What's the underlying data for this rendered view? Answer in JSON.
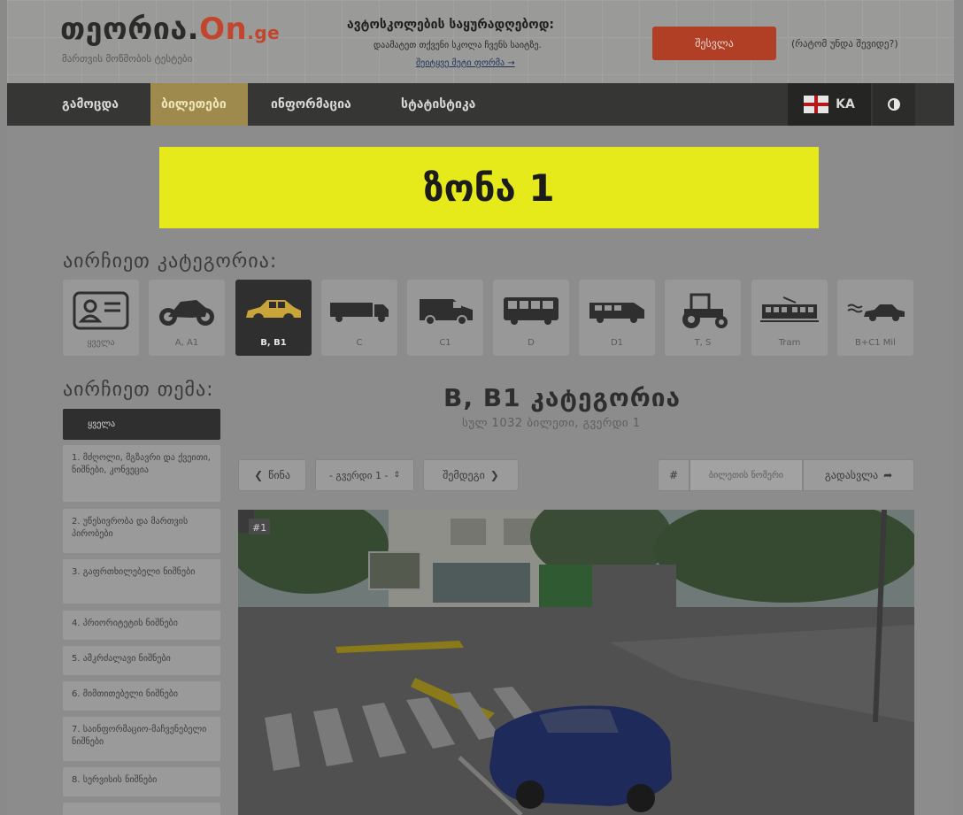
{
  "header": {
    "logo_main": "თეორია.",
    "logo_on": "On",
    "logo_ge": ".ge",
    "logo_subtitle": "მართვის მოწმობის ტესტები",
    "promo_title": "ავტოსკოლების საყურადღებოდ:",
    "promo_line": "დაამატეთ თქვენი სკოლა ჩვენს საიტზე.",
    "promo_link": "შეიტყვე მეტი ფორმა →",
    "login_button": "შესვლა",
    "why_link": "(რატომ უნდა შევიდე?)"
  },
  "nav": {
    "items": [
      {
        "label": "გამოცდა"
      },
      {
        "label": "ბილეთები"
      },
      {
        "label": "ინფორმაცია"
      },
      {
        "label": "სტატისტიკა"
      }
    ],
    "active_index": 1,
    "lang_label": "KA"
  },
  "zone_banner": "ზონა 1",
  "choose_category_title": "აირჩიეთ კატეგორია:",
  "categories": [
    {
      "label": "ყველა",
      "icon": "id-card-icon"
    },
    {
      "label": "A, A1",
      "icon": "motorcycle-icon"
    },
    {
      "label": "B, B1",
      "icon": "car-icon"
    },
    {
      "label": "C",
      "icon": "truck-icon"
    },
    {
      "label": "C1",
      "icon": "van-icon"
    },
    {
      "label": "D",
      "icon": "bus-icon"
    },
    {
      "label": "D1",
      "icon": "minibus-icon"
    },
    {
      "label": "T, S",
      "icon": "tractor-icon"
    },
    {
      "label": "Tram",
      "icon": "tram-icon"
    },
    {
      "label": "B+C1 Mil",
      "icon": "military-car-icon"
    }
  ],
  "active_category_index": 2,
  "choose_topic_title": "აირჩიეთ თემა:",
  "topics": [
    {
      "label": "ყველა"
    },
    {
      "label": "1. მძღოლი, მგზავრი და ქვეითი, ნიშნები, კონვეცია"
    },
    {
      "label": "2. უწესივრობა და მართვის პირობები"
    },
    {
      "label": "3. გაფრთხილებელი ნიშნები"
    },
    {
      "label": "4. პრიორიტეტის ნიშნები"
    },
    {
      "label": "5. ამკრძალავი ნიშნები"
    },
    {
      "label": "6. მიმთითებელი ნიშნები"
    },
    {
      "label": "7. საინფორმაციო-მაჩვენებელი ნიშნები"
    },
    {
      "label": "8. სერვისის ნიშნები"
    }
  ],
  "ticket": {
    "title": "B, B1 კატეგორია",
    "subtitle": "სულ 1032 ბილეთი, გვერდი 1"
  },
  "controls": {
    "prev": "წინა",
    "page_select": "- გვერდი 1 -",
    "next": "შემდეგი",
    "hash": "#",
    "ticket_number_placeholder": "ბილეთის ნომერი",
    "goto": "გადასვლა"
  },
  "photo": {
    "badge": "#1"
  },
  "colors": {
    "accent_red": "#b03f26",
    "nav_bg": "#363634",
    "nav_active": "#9f8a4d",
    "zone_yellow": "#e6ea1b"
  }
}
